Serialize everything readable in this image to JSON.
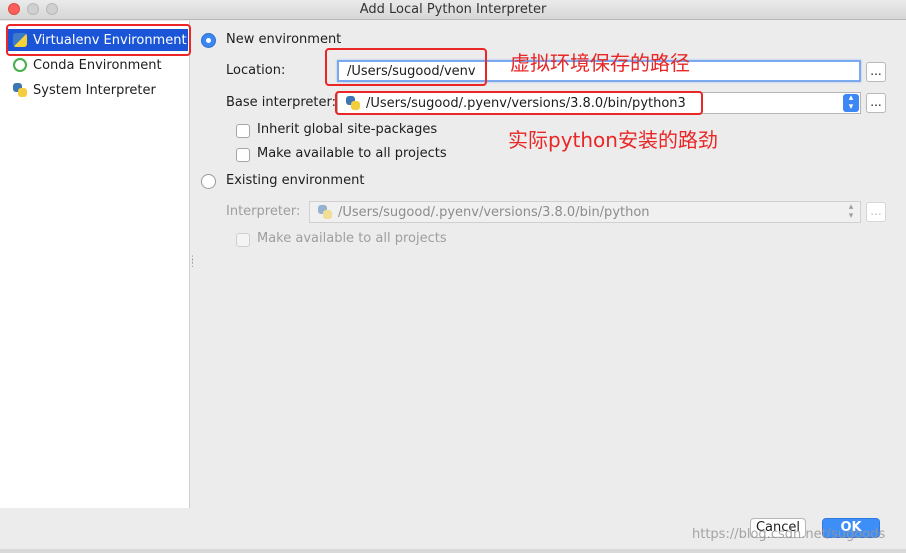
{
  "window": {
    "title": "Add Local Python Interpreter"
  },
  "sidebar": {
    "items": [
      {
        "label": "Virtualenv Environment",
        "icon": "virtualenv-icon",
        "selected": true
      },
      {
        "label": "Conda Environment",
        "icon": "conda-icon",
        "selected": false
      },
      {
        "label": "System Interpreter",
        "icon": "python-icon",
        "selected": false
      }
    ]
  },
  "new_env": {
    "radio_label": "New environment",
    "location_label": "Location:",
    "location_value": "/Users/sugood/venv",
    "base_label": "Base interpreter:",
    "base_value": "/Users/sugood/.pyenv/versions/3.8.0/bin/python3",
    "inherit_label": "Inherit global site-packages",
    "make_available_label": "Make available to all projects",
    "browse_label": "..."
  },
  "existing_env": {
    "radio_label": "Existing environment",
    "interpreter_label": "Interpreter:",
    "interpreter_value": "/Users/sugood/.pyenv/versions/3.8.0/bin/python",
    "make_available_label": "Make available to all projects",
    "browse_label": "..."
  },
  "annotations": {
    "location_note": "虚拟环境保存的路径",
    "interpreter_note": "实际python安装的路劲"
  },
  "buttons": {
    "cancel": "Cancel",
    "ok": "OK"
  },
  "watermark": "https://blog.csdn.net/sugoods",
  "colors": {
    "accent": "#1a55d8",
    "annotation": "#ea2626",
    "ok_button": "#3e8ef8"
  }
}
